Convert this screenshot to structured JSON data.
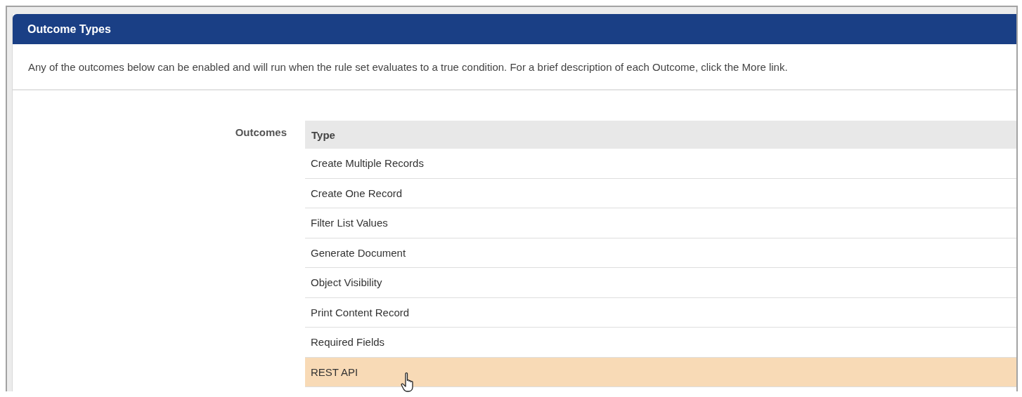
{
  "panel": {
    "title": "Outcome Types",
    "description": "Any of the outcomes below can be enabled and will run when the rule set evaluates to a true condition. For a brief description of each Outcome, click the More link."
  },
  "field": {
    "label": "Outcomes"
  },
  "table": {
    "columns": [
      "Type"
    ],
    "rows": [
      {
        "type": "Create Multiple Records",
        "selected": false
      },
      {
        "type": "Create One Record",
        "selected": false
      },
      {
        "type": "Filter List Values",
        "selected": false
      },
      {
        "type": "Generate Document",
        "selected": false
      },
      {
        "type": "Object Visibility",
        "selected": false
      },
      {
        "type": "Print Content Record",
        "selected": false
      },
      {
        "type": "Required Fields",
        "selected": false
      },
      {
        "type": "REST API",
        "selected": true
      }
    ]
  }
}
